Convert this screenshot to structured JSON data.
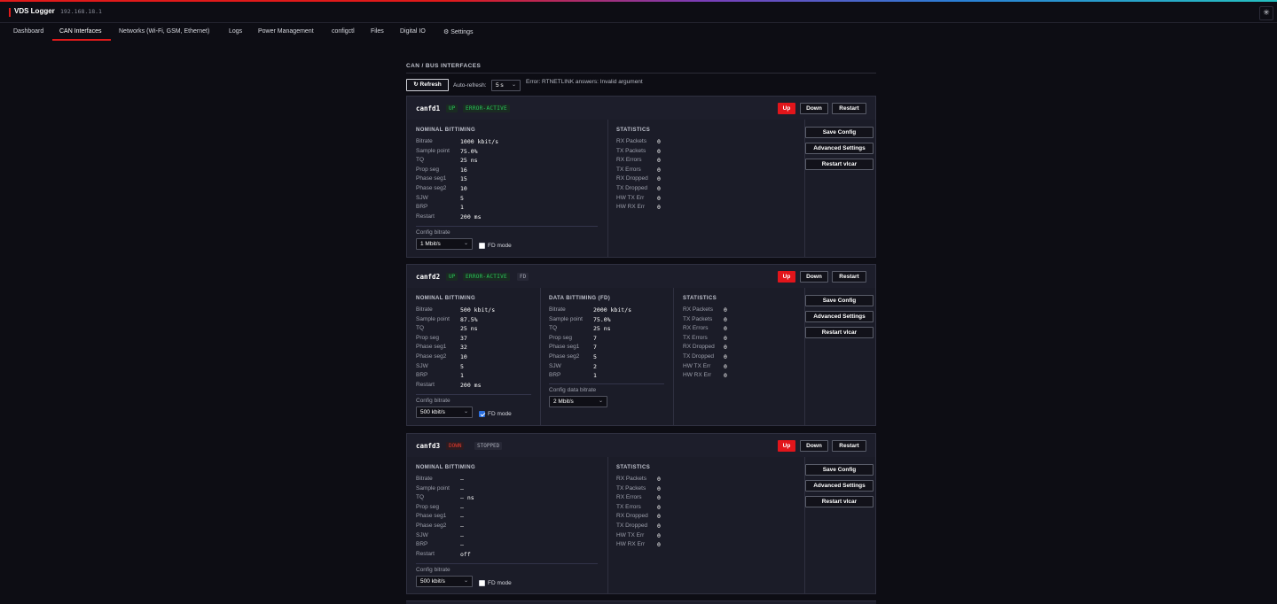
{
  "app": {
    "title": "VDS Logger",
    "ip": "192.168.18.1",
    "settings_glyph": "✳"
  },
  "nav": [
    {
      "label": "Dashboard",
      "active": false
    },
    {
      "label": "CAN Interfaces",
      "active": true
    },
    {
      "label": "Networks (Wi-Fi, GSM, Ethernet)",
      "active": false
    },
    {
      "label": "Logs",
      "active": false
    },
    {
      "label": "Power Management",
      "active": false
    },
    {
      "label": "configctl",
      "active": false
    },
    {
      "label": "Files",
      "active": false
    },
    {
      "label": "Digital IO",
      "active": false
    },
    {
      "label": "⚙ Settings",
      "active": false
    }
  ],
  "section": {
    "title": "CAN / BUS INTERFACES",
    "refresh_label": "↻ Refresh",
    "autorefresh_label": "Auto-refresh:",
    "autorefresh_value": "5 s",
    "error": "Error: RTNETLINK answers: Invalid argument"
  },
  "labels": {
    "nominal": "NOMINAL BITTIMING",
    "data": "DATA BITTIMING (FD)",
    "statistics": "STATISTICS",
    "config_bitrate": "Config bitrate",
    "config_data_bitrate": "Config data bitrate",
    "fd_mode": "FD mode",
    "up": "Up",
    "down": "Down",
    "restart": "Restart",
    "save_config": "Save Config",
    "advanced_settings": "Advanced Settings",
    "restart_vlcar": "Restart vlcar",
    "select_chevron": "⌄"
  },
  "interfaces": [
    {
      "name": "canfd1",
      "badges": [
        {
          "text": "UP",
          "kind": "up"
        },
        {
          "text": "ERROR-ACTIVE",
          "kind": "err"
        }
      ],
      "nominal": [
        [
          "Bitrate",
          "1000 kbit/s"
        ],
        [
          "Sample point",
          "75.0%"
        ],
        [
          "TQ",
          "25 ns"
        ],
        [
          "Prop seg",
          "16"
        ],
        [
          "Phase seg1",
          "15"
        ],
        [
          "Phase seg2",
          "10"
        ],
        [
          "SJW",
          "5"
        ],
        [
          "BRP",
          "1"
        ],
        [
          "Restart",
          "200 ms"
        ]
      ],
      "data": null,
      "stats": [
        [
          "RX Packets",
          "0"
        ],
        [
          "TX Packets",
          "0"
        ],
        [
          "RX Errors",
          "0"
        ],
        [
          "TX Errors",
          "0"
        ],
        [
          "RX Dropped",
          "0"
        ],
        [
          "TX Dropped",
          "0"
        ],
        [
          "HW TX Err",
          "0"
        ],
        [
          "HW RX Err",
          "0"
        ]
      ],
      "config_bitrate": "1 Mbit/s",
      "fd_mode": false
    },
    {
      "name": "canfd2",
      "badges": [
        {
          "text": "UP",
          "kind": "up"
        },
        {
          "text": "ERROR-ACTIVE",
          "kind": "err"
        },
        {
          "text": "FD",
          "kind": "neutral"
        }
      ],
      "nominal": [
        [
          "Bitrate",
          "500 kbit/s"
        ],
        [
          "Sample point",
          "87.5%"
        ],
        [
          "TQ",
          "25 ns"
        ],
        [
          "Prop seg",
          "37"
        ],
        [
          "Phase seg1",
          "32"
        ],
        [
          "Phase seg2",
          "10"
        ],
        [
          "SJW",
          "5"
        ],
        [
          "BRP",
          "1"
        ],
        [
          "Restart",
          "200 ms"
        ]
      ],
      "data": [
        [
          "Bitrate",
          "2000 kbit/s"
        ],
        [
          "Sample point",
          "75.0%"
        ],
        [
          "TQ",
          "25 ns"
        ],
        [
          "Prop seg",
          "7"
        ],
        [
          "Phase seg1",
          "7"
        ],
        [
          "Phase seg2",
          "5"
        ],
        [
          "SJW",
          "2"
        ],
        [
          "BRP",
          "1"
        ]
      ],
      "stats": [
        [
          "RX Packets",
          "0"
        ],
        [
          "TX Packets",
          "0"
        ],
        [
          "RX Errors",
          "0"
        ],
        [
          "TX Errors",
          "0"
        ],
        [
          "RX Dropped",
          "0"
        ],
        [
          "TX Dropped",
          "0"
        ],
        [
          "HW TX Err",
          "0"
        ],
        [
          "HW RX Err",
          "0"
        ]
      ],
      "config_bitrate": "500 kbit/s",
      "config_data_bitrate": "2 Mbit/s",
      "fd_mode": true
    },
    {
      "name": "canfd3",
      "badges": [
        {
          "text": "DOWN",
          "kind": "down"
        },
        {
          "text": "STOPPED",
          "kind": "neutral"
        }
      ],
      "nominal": [
        [
          "Bitrate",
          "—"
        ],
        [
          "Sample point",
          "—"
        ],
        [
          "TQ",
          "— ns"
        ],
        [
          "Prop seg",
          "—"
        ],
        [
          "Phase seg1",
          "—"
        ],
        [
          "Phase seg2",
          "—"
        ],
        [
          "SJW",
          "—"
        ],
        [
          "BRP",
          "—"
        ],
        [
          "Restart",
          "off"
        ]
      ],
      "data": null,
      "stats": [
        [
          "RX Packets",
          "0"
        ],
        [
          "TX Packets",
          "0"
        ],
        [
          "RX Errors",
          "0"
        ],
        [
          "TX Errors",
          "0"
        ],
        [
          "RX Dropped",
          "0"
        ],
        [
          "TX Dropped",
          "0"
        ],
        [
          "HW TX Err",
          "0"
        ],
        [
          "HW RX Err",
          "0"
        ]
      ],
      "config_bitrate": "500 kbit/s",
      "fd_mode": false
    }
  ]
}
